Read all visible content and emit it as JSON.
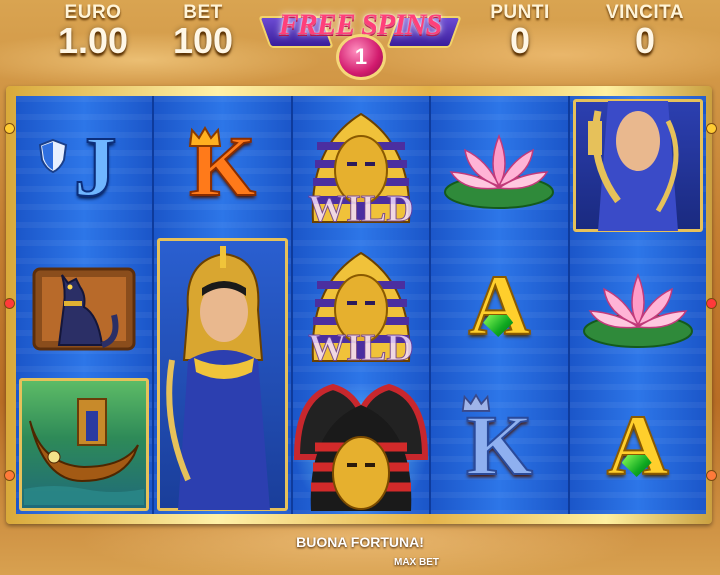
{
  "hud": {
    "euro_label": "EURO",
    "euro_value": "1.00",
    "bet_label": "BET",
    "bet_value": "100",
    "punti_label": "PUNTI",
    "punti_value": "0",
    "vincita_label": "VINCITA",
    "vincita_value": "0"
  },
  "free_spins": {
    "title": "FREE SPINS",
    "count": "1"
  },
  "symbols": {
    "jack": "J",
    "king": "K",
    "ace": "A",
    "wild": "WILD"
  },
  "status": {
    "message": "BUONA FORTUNA!",
    "max_bet": "MAX BET"
  },
  "colors": {
    "reel_blue": "#2d76e8",
    "frame_gold": "#e4b34a",
    "banner_pink": "#ff3f7a"
  },
  "icons": [
    "shield-icon",
    "crown-icon",
    "pharaoh-mask-icon",
    "lotus-flower-icon",
    "cat-statue-icon",
    "egyptian-boat-icon",
    "cleopatra-icon",
    "emerald-gem-icon"
  ]
}
